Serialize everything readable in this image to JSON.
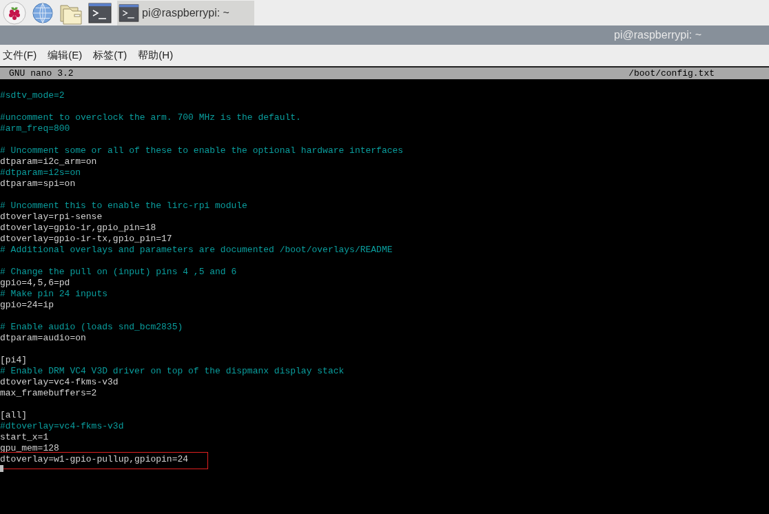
{
  "taskbar": {
    "tasks": [
      {
        "title": "pi@raspberrypi: ~",
        "selected": true
      }
    ]
  },
  "window": {
    "title": "pi@raspberrypi: ~"
  },
  "menu": [
    "文件(F)",
    "编辑(E)",
    "标签(T)",
    "帮助(H)"
  ],
  "nano": {
    "version": "GNU nano 3.2",
    "file": "/boot/config.txt"
  },
  "lines": [
    {
      "kind": "blank"
    },
    {
      "kind": "comment",
      "text": "#sdtv_mode=2"
    },
    {
      "kind": "blank"
    },
    {
      "kind": "comment",
      "text": "#uncomment to overclock the arm. 700 MHz is the default."
    },
    {
      "kind": "comment",
      "text": "#arm_freq=800"
    },
    {
      "kind": "blank"
    },
    {
      "kind": "comment",
      "text": "# Uncomment some or all of these to enable the optional hardware interfaces"
    },
    {
      "kind": "setting",
      "text": "dtparam=i2c_arm=on"
    },
    {
      "kind": "comment",
      "text": "#dtparam=i2s=on"
    },
    {
      "kind": "setting",
      "text": "dtparam=spi=on"
    },
    {
      "kind": "blank"
    },
    {
      "kind": "comment",
      "text": "# Uncomment this to enable the lirc-rpi module"
    },
    {
      "kind": "setting",
      "text": "dtoverlay=rpi-sense"
    },
    {
      "kind": "setting",
      "text": "dtoverlay=gpio-ir,gpio_pin=18"
    },
    {
      "kind": "setting",
      "text": "dtoverlay=gpio-ir-tx,gpio_pin=17"
    },
    {
      "kind": "comment",
      "text": "# Additional overlays and parameters are documented /boot/overlays/README"
    },
    {
      "kind": "blank"
    },
    {
      "kind": "comment",
      "text": "# Change the pull on (input) pins 4 ,5 and 6"
    },
    {
      "kind": "setting",
      "text": "gpio=4,5,6=pd"
    },
    {
      "kind": "comment",
      "text": "# Make pin 24 inputs"
    },
    {
      "kind": "setting",
      "text": "gpio=24=ip"
    },
    {
      "kind": "blank"
    },
    {
      "kind": "comment",
      "text": "# Enable audio (loads snd_bcm2835)"
    },
    {
      "kind": "setting",
      "text": "dtparam=audio=on"
    },
    {
      "kind": "blank"
    },
    {
      "kind": "setting",
      "text": "[pi4]"
    },
    {
      "kind": "comment",
      "text": "# Enable DRM VC4 V3D driver on top of the dispmanx display stack"
    },
    {
      "kind": "setting",
      "text": "dtoverlay=vc4-fkms-v3d"
    },
    {
      "kind": "setting",
      "text": "max_framebuffers=2"
    },
    {
      "kind": "blank"
    },
    {
      "kind": "setting",
      "text": "[all]"
    },
    {
      "kind": "comment",
      "text": "#dtoverlay=vc4-fkms-v3d"
    },
    {
      "kind": "setting",
      "text": "start_x=1"
    },
    {
      "kind": "setting",
      "text": "gpu_mem=128"
    },
    {
      "kind": "setting",
      "text": "dtoverlay=w1-gpio-pullup,gpiopin=24",
      "highlighted": true
    },
    {
      "kind": "cursor"
    }
  ]
}
